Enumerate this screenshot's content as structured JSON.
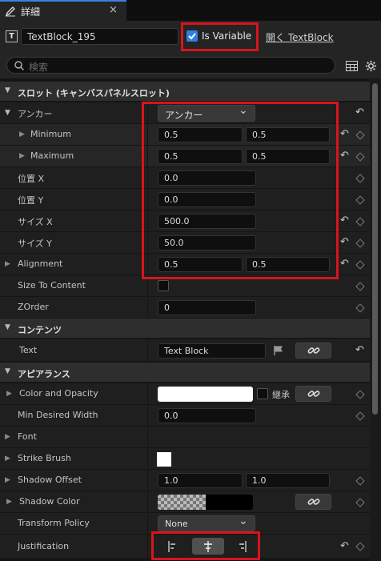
{
  "tab": {
    "title": "詳細",
    "close": "×"
  },
  "header": {
    "widget_name": "TextBlock_195",
    "is_variable_label": "Is Variable",
    "open_link": "開く TextBlock",
    "search_placeholder": "検索"
  },
  "slot": {
    "title": "スロット (キャンバスパネルスロット)",
    "anchor_label": "アンカー",
    "anchor_value": "アンカー",
    "minimum_label": "Minimum",
    "minimum": [
      "0.5",
      "0.5"
    ],
    "maximum_label": "Maximum",
    "maximum": [
      "0.5",
      "0.5"
    ],
    "pos_x_label": "位置 X",
    "pos_x": "0.0",
    "pos_y_label": "位置 Y",
    "pos_y": "0.0",
    "size_x_label": "サイズ X",
    "size_x": "500.0",
    "size_y_label": "サイズ Y",
    "size_y": "50.0",
    "alignment_label": "Alignment",
    "alignment": [
      "0.5",
      "0.5"
    ],
    "size_to_content_label": "Size To Content",
    "zorder_label": "ZOrder",
    "zorder": "0"
  },
  "content": {
    "title": "コンテンツ",
    "text_label": "Text",
    "text_value": "Text Block"
  },
  "appearance": {
    "title": "アピアランス",
    "color_label": "Color and Opacity",
    "inherit_label": "継承",
    "min_width_label": "Min Desired Width",
    "min_width": "0.0",
    "font_label": "Font",
    "strike_label": "Strike Brush",
    "shadow_offset_label": "Shadow Offset",
    "shadow_offset": [
      "1.0",
      "1.0"
    ],
    "shadow_color_label": "Shadow Color",
    "transform_policy_label": "Transform Policy",
    "transform_policy": "None",
    "justification_label": "Justification"
  },
  "icons": {
    "reset": "↶",
    "expand": "▶",
    "collapse": "▼",
    "dropdown": "⌄"
  },
  "colors": {
    "accent": "#2f7fe0",
    "highlight": "#d8141c"
  }
}
